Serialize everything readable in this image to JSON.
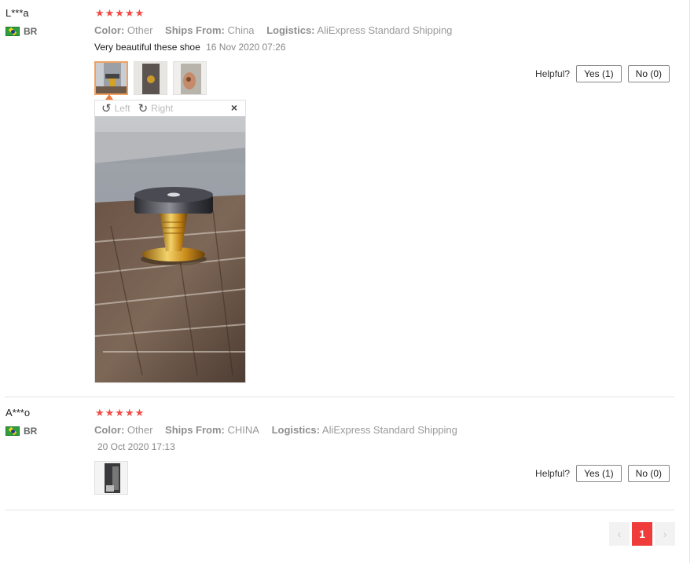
{
  "reviews": [
    {
      "user": "L***a",
      "country": "BR",
      "stars": "★★★★★",
      "color_label": "Color:",
      "color_value": "Other",
      "ships_label": "Ships From:",
      "ships_value": "China",
      "logistics_label": "Logistics:",
      "logistics_value": "AliExpress Standard Shipping",
      "text": "Very beautiful these shoe",
      "date": "16 Nov 2020 07:26",
      "helpful_label": "Helpful?",
      "yes_label": "Yes (1)",
      "no_label": "No (0)",
      "viewer": {
        "rotate_left": "Left",
        "rotate_right": "Right",
        "close": "×"
      }
    },
    {
      "user": "A***o",
      "country": "BR",
      "stars": "★★★★★",
      "color_label": "Color:",
      "color_value": "Other",
      "ships_label": "Ships From:",
      "ships_value": "CHINA",
      "logistics_label": "Logistics:",
      "logistics_value": "AliExpress Standard Shipping",
      "text": "",
      "date": "20 Oct 2020 17:13",
      "helpful_label": "Helpful?",
      "yes_label": "Yes (1)",
      "no_label": "No (0)"
    }
  ],
  "pagination": {
    "prev": "‹",
    "current": "1",
    "next": "›"
  },
  "colors": {
    "star": "#f04b46",
    "active_page": "#ef3b39",
    "active_thumb_border": "#f0a060"
  }
}
